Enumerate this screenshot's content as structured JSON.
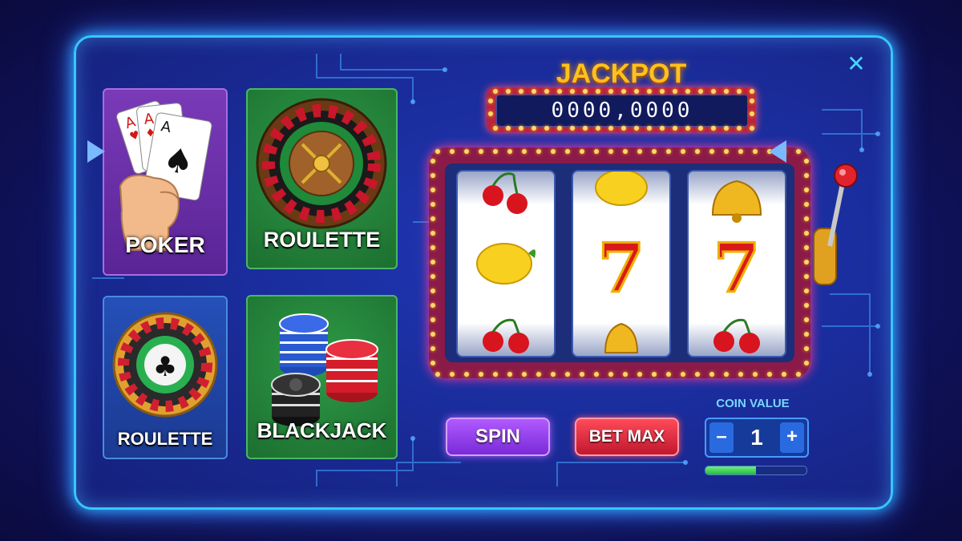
{
  "games": [
    {
      "label": "POKER"
    },
    {
      "label": "ROULETTE"
    },
    {
      "label": "ROULETTE"
    },
    {
      "label": "BLACKJACK"
    }
  ],
  "jackpot": {
    "title": "JACKPOT",
    "value": "0000,0000"
  },
  "reels": [
    [
      "cherry",
      "lemon",
      "cherry"
    ],
    [
      "lemon",
      "seven",
      "bell"
    ],
    [
      "bell",
      "seven",
      "cherry"
    ]
  ],
  "controls": {
    "spin_label": "SPIN",
    "bet_max_label": "BET MAX",
    "coin_value_label": "COIN VALUE",
    "coin_value": "1",
    "minus_label": "–",
    "plus_label": "+",
    "progress_fraction": 0.5
  },
  "close_label": "✕",
  "colors": {
    "accent": "#35c8ff",
    "spin": "#9a46f0",
    "bet": "#e02a40",
    "jackpot": "#ffc21a"
  }
}
